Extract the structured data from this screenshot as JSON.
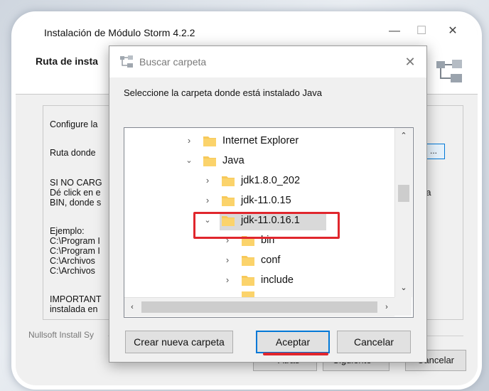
{
  "installer": {
    "title": "Instalación de Módulo Storm 4.2.2",
    "header_title": "Ruta de insta",
    "group_label": "Configure la",
    "path_label": "Ruta donde",
    "browse_label": "...",
    "side_text": "ta",
    "info_lines": [
      "SI NO CARG",
      "Dé click en e",
      "BIN, donde s"
    ],
    "example_lines": [
      "Ejemplo:",
      "C:\\Program I",
      "C:\\Program I",
      "C:\\Archivos",
      "C:\\Archivos"
    ],
    "important_lines": [
      "IMPORTANT",
      "instalada en"
    ],
    "footer": "Nullsoft Install Sy",
    "back_label": "< Atrás",
    "next_label": "Siguiente >",
    "cancel_label": "Cancelar",
    "minimize": "—",
    "maximize": "☐",
    "close": "✕"
  },
  "dialog": {
    "title": "Buscar carpeta",
    "close": "✕",
    "prompt": "Seleccione la carpeta donde está instalado Java",
    "tree": [
      {
        "label": "Internet Explorer",
        "expanded": false
      },
      {
        "label": "Java",
        "expanded": true
      },
      {
        "label": "jdk1.8.0_202",
        "expanded": false
      },
      {
        "label": "jdk-11.0.15",
        "expanded": false
      },
      {
        "label": "jdk-11.0.16.1",
        "expanded": true,
        "selected": true
      },
      {
        "label": "bin",
        "expanded": false
      },
      {
        "label": "conf",
        "expanded": false
      },
      {
        "label": "include",
        "expanded": false
      }
    ],
    "new_folder_label": "Crear nueva carpeta",
    "accept_label": "Aceptar",
    "cancel_label": "Cancelar"
  },
  "colors": {
    "highlight": "#e0262d",
    "folder": "#f7c95a",
    "selection": "#d9d9d9",
    "focus": "#0078d7"
  }
}
